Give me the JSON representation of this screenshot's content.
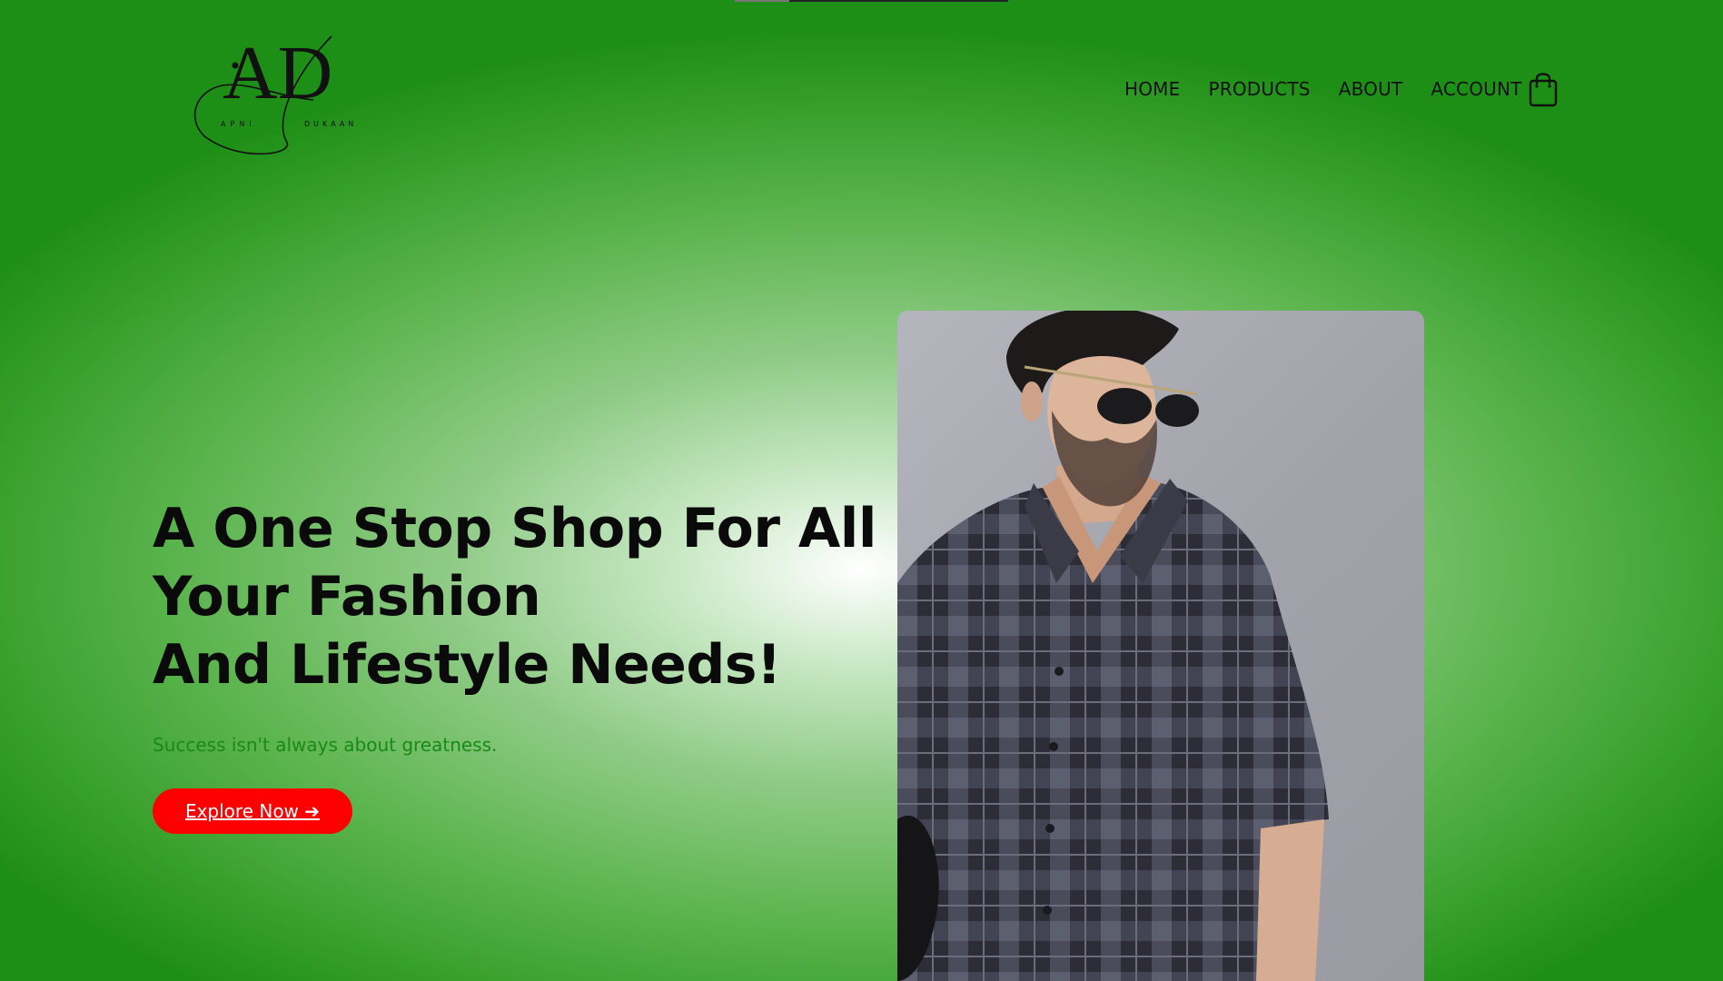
{
  "brand": {
    "logo_monogram": "AD",
    "logo_left_word": "APNI",
    "logo_right_word": "DUKAAN"
  },
  "nav": {
    "items": [
      {
        "label": "HOME"
      },
      {
        "label": "PRODUCTS"
      },
      {
        "label": "ABOUT"
      },
      {
        "label": "ACCOUNT"
      }
    ],
    "cart_icon": "shopping-bag-icon"
  },
  "hero": {
    "title_lines": [
      "A One Stop Shop For All",
      "Your Fashion",
      "And Lifestyle Needs!"
    ],
    "tagline": "Success isn't always about greatness.",
    "cta_label": "Explore Now ➔",
    "image_alt": "Model wearing black checked shirt and sunglasses"
  },
  "colors": {
    "accent_green": "#1a8a17",
    "cta_red": "#ff0000",
    "background_green": "#2f9a24"
  }
}
